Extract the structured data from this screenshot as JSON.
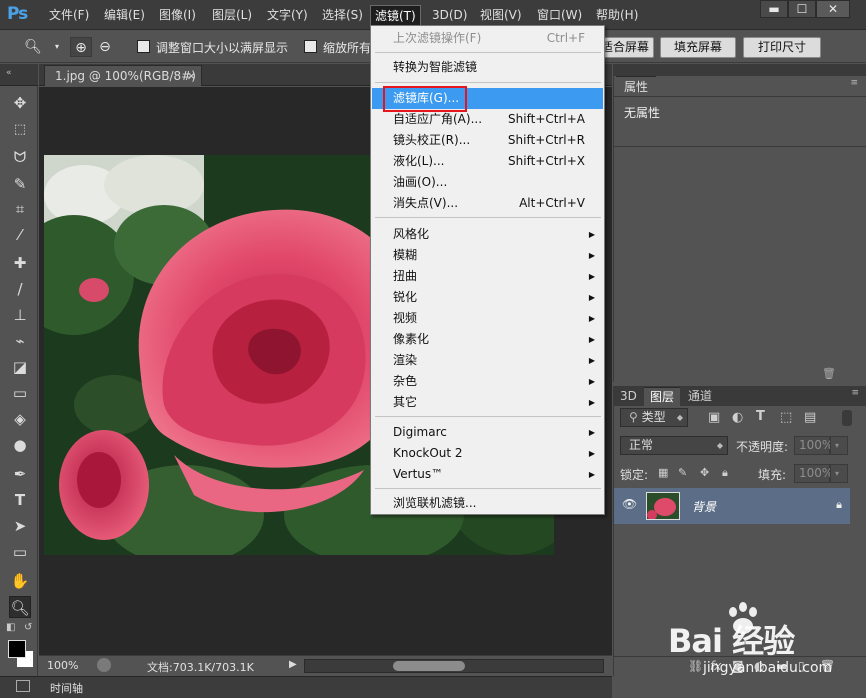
{
  "app": {
    "logo": "Ps"
  },
  "menubar": {
    "items": [
      "文件(F)",
      "编辑(E)",
      "图像(I)",
      "图层(L)",
      "文字(Y)",
      "选择(S)",
      "滤镜(T)",
      "3D(D)",
      "视图(V)",
      "窗口(W)",
      "帮助(H)"
    ],
    "active_index": 6
  },
  "window_controls": {
    "minimize": "▬",
    "maximize": "☐",
    "close": "✕"
  },
  "options": {
    "resize_windows_label": "调整窗口大小以满屏显示",
    "zoom_all_label": "缩放所有",
    "fit_screen_button": "适合屏幕",
    "fill_screen_button": "填充屏幕",
    "print_size_button": "打印尺寸"
  },
  "document": {
    "tab_title": "1.jpg @ 100%(RGB/8#)",
    "zoom": "100%",
    "doc_info": "文档:703.1K/703.1K"
  },
  "timeline": {
    "label": "时间轴"
  },
  "properties": {
    "tab": "属性",
    "empty_text": "无属性"
  },
  "layers": {
    "tabs": [
      "3D",
      "图层",
      "通道"
    ],
    "active_tab": 1,
    "filter_kind": "类型",
    "blend_mode": "正常",
    "opacity_label": "不透明度:",
    "opacity_value": "100%",
    "lock_label": "锁定:",
    "fill_label": "填充:",
    "fill_value": "100%",
    "layer_name": "背景"
  },
  "filter_menu": {
    "items": [
      {
        "label": "上次滤镜操作(F)",
        "shortcut": "Ctrl+F",
        "disabled": true
      },
      {
        "label": "转换为智能滤镜"
      },
      {
        "label": "滤镜库(G)...",
        "highlight": true
      },
      {
        "label": "自适应广角(A)...",
        "shortcut": "Shift+Ctrl+A"
      },
      {
        "label": "镜头校正(R)...",
        "shortcut": "Shift+Ctrl+R"
      },
      {
        "label": "液化(L)...",
        "shortcut": "Shift+Ctrl+X"
      },
      {
        "label": "油画(O)..."
      },
      {
        "label": "消失点(V)...",
        "shortcut": "Alt+Ctrl+V"
      },
      {
        "label": "风格化",
        "submenu": true
      },
      {
        "label": "模糊",
        "submenu": true
      },
      {
        "label": "扭曲",
        "submenu": true
      },
      {
        "label": "锐化",
        "submenu": true
      },
      {
        "label": "视频",
        "submenu": true
      },
      {
        "label": "像素化",
        "submenu": true
      },
      {
        "label": "渲染",
        "submenu": true
      },
      {
        "label": "杂色",
        "submenu": true
      },
      {
        "label": "其它",
        "submenu": true
      },
      {
        "label": "Digimarc",
        "submenu": true
      },
      {
        "label": "KnockOut 2",
        "submenu": true
      },
      {
        "label": "Vertus™",
        "submenu": true
      },
      {
        "label": "浏览联机滤镜..."
      }
    ]
  },
  "watermark": {
    "text": "Bai  经验",
    "url": "jingyan.baidu.com"
  },
  "colors": {
    "accent": "#3c9bf0",
    "highlight_box": "#e5141e",
    "layer_selected": "#5c6e87"
  }
}
